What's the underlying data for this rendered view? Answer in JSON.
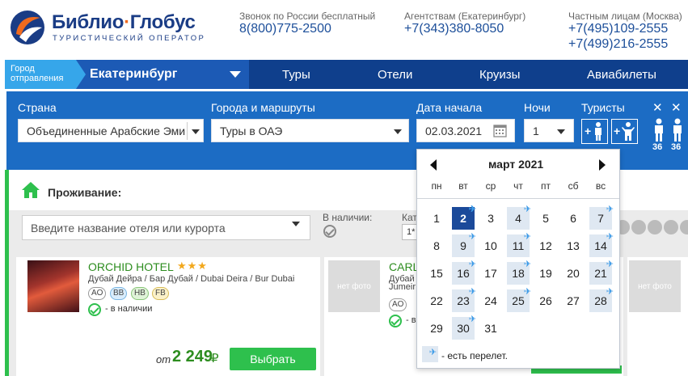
{
  "header": {
    "logo_name_1": "Библио",
    "logo_dot": "·",
    "logo_name_2": "Глобус",
    "logo_sub": "ТУРИСТИЧЕСКИЙ ОПЕРАТОР",
    "contacts": [
      {
        "label": "Звонок по России бесплатный",
        "numbers": [
          "8(800)775-2500"
        ]
      },
      {
        "label": "Агентствам (Екатеринбург)",
        "numbers": [
          "+7(343)380-8050"
        ]
      },
      {
        "label": "Частным лицам (Москва)",
        "numbers": [
          "+7(495)109-2555",
          "+7(499)216-2555"
        ]
      }
    ]
  },
  "nav": {
    "city_tag_1": "Город",
    "city_tag_2": "отправления",
    "city": "Екатеринбург",
    "items": [
      "Туры",
      "Отели",
      "Круизы",
      "Авиабилеты"
    ]
  },
  "search": {
    "country_label": "Страна",
    "country_value": "Объединенные Арабские Эмир",
    "route_label": "Города и маршруты",
    "route_value": "Туры в ОАЭ",
    "date_label": "Дата начала",
    "date_value": "02.03.2021",
    "nights_label": "Ночи",
    "nights_value": "1",
    "tourists_label": "Туристы",
    "child_ages": [
      "36",
      "36"
    ]
  },
  "lodging": {
    "label": "Проживание:",
    "hotel_search_placeholder": "Введите название отеля или курорта",
    "avail_label": "В наличии:",
    "category_label": "Кате",
    "category_value": "1*"
  },
  "hotels": [
    {
      "name": "ORCHID HOTEL",
      "stars": "★★★",
      "location": "Дубай Дейра / Бар Дубай / Dubai Deira / Bur Dubai",
      "boards": [
        "AO",
        "BB",
        "HB",
        "FB"
      ],
      "availability": "- в наличии",
      "price_prefix": "от",
      "price": "2 249",
      "currency": "₽",
      "button": "Выбрать"
    },
    {
      "name": "CARL",
      "location_1": "Дубай",
      "location_2": "Jumeir",
      "boards": [
        "AO"
      ],
      "availability": "- в",
      "nophoto": "нет фото"
    },
    {
      "nophoto": "нет фото"
    }
  ],
  "calendar": {
    "title": "март 2021",
    "weekdays": [
      "пн",
      "вт",
      "ср",
      "чт",
      "пт",
      "сб",
      "вс"
    ],
    "selected_day": 2,
    "flight_days": [
      4,
      7,
      9,
      11,
      14,
      16,
      18,
      21,
      23,
      25,
      28,
      30
    ],
    "legend": "- есть перелет.",
    "colors": {
      "selected": "#1b4a9a",
      "flight": "#dfe8f2",
      "plane": "#3a9ae8"
    }
  },
  "colors": {
    "brand": "#1a3c85",
    "nav": "#0f3f8c",
    "search_panel": "#1c6cc4",
    "accent_green": "#2ec04d"
  }
}
